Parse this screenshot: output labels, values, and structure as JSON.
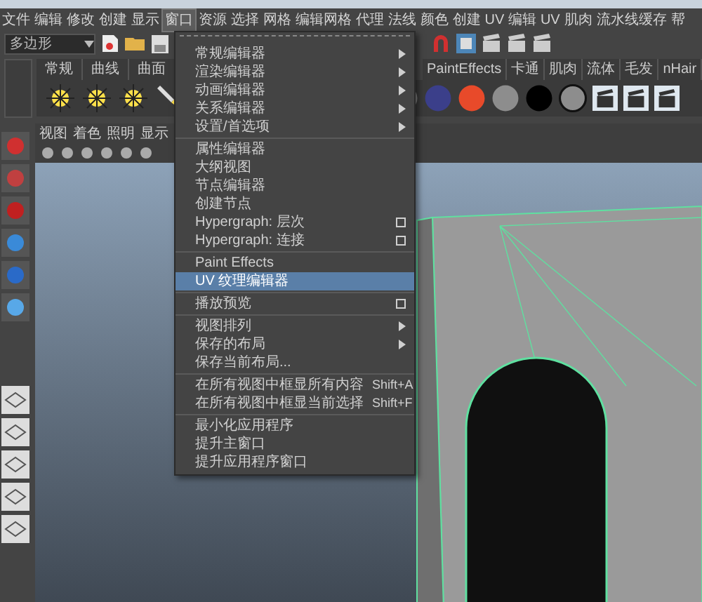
{
  "menubar": [
    {
      "label": "文件",
      "selected": false
    },
    {
      "label": "编辑",
      "selected": false
    },
    {
      "label": "修改",
      "selected": false
    },
    {
      "label": "创建",
      "selected": false
    },
    {
      "label": "显示",
      "selected": false
    },
    {
      "label": "窗口",
      "selected": true
    },
    {
      "label": "资源",
      "selected": false
    },
    {
      "label": "选择",
      "selected": false
    },
    {
      "label": "网格",
      "selected": false
    },
    {
      "label": "编辑网格",
      "selected": false
    },
    {
      "label": "代理",
      "selected": false
    },
    {
      "label": "法线",
      "selected": false
    },
    {
      "label": "颜色",
      "selected": false
    },
    {
      "label": "创建 UV",
      "selected": false
    },
    {
      "label": "编辑 UV",
      "selected": false
    },
    {
      "label": "肌肉",
      "selected": false
    },
    {
      "label": "流水线缓存",
      "selected": false
    },
    {
      "label": "帮",
      "selected": false
    }
  ],
  "mode_dropdown": {
    "value": "多边形"
  },
  "shelf_tabs_left": [
    "常规",
    "曲线",
    "曲面"
  ],
  "shelf_tabs_right": [
    "PaintEffects",
    "卡通",
    "肌肉",
    "流体",
    "毛发",
    "nHair"
  ],
  "panel_menu": [
    "视图",
    "着色",
    "照明",
    "显示"
  ],
  "window_menu": [
    [
      {
        "label": "常规编辑器",
        "kind": "submenu",
        "selected": false
      },
      {
        "label": "渲染编辑器",
        "kind": "submenu",
        "selected": false
      },
      {
        "label": "动画编辑器",
        "kind": "submenu",
        "selected": false
      },
      {
        "label": "关系编辑器",
        "kind": "submenu",
        "selected": false
      },
      {
        "label": "设置/首选项",
        "kind": "submenu",
        "selected": false
      }
    ],
    [
      {
        "label": "属性编辑器",
        "kind": "plain",
        "selected": false
      },
      {
        "label": "大纲视图",
        "kind": "plain",
        "selected": false
      },
      {
        "label": "节点编辑器",
        "kind": "plain",
        "selected": false
      },
      {
        "label": "创建节点",
        "kind": "plain",
        "selected": false
      },
      {
        "label": "Hypergraph: 层次",
        "kind": "option",
        "selected": false
      },
      {
        "label": "Hypergraph: 连接",
        "kind": "option",
        "selected": false
      }
    ],
    [
      {
        "label": "Paint Effects",
        "kind": "plain",
        "selected": false
      },
      {
        "label": "UV 纹理编辑器",
        "kind": "plain",
        "selected": true
      }
    ],
    [
      {
        "label": "播放预览",
        "kind": "option",
        "selected": false
      }
    ],
    [
      {
        "label": "视图排列",
        "kind": "submenu",
        "selected": false
      },
      {
        "label": "保存的布局",
        "kind": "submenu",
        "selected": false
      },
      {
        "label": "保存当前布局...",
        "kind": "plain",
        "selected": false
      }
    ],
    [
      {
        "label": "在所有视图中框显所有内容",
        "kind": "shortcut",
        "shortcut": "Shift+A",
        "selected": false
      },
      {
        "label": "在所有视图中框显当前选择",
        "kind": "shortcut",
        "shortcut": "Shift+F",
        "selected": false
      }
    ],
    [
      {
        "label": "最小化应用程序",
        "kind": "plain",
        "selected": false
      },
      {
        "label": "提升主窗口",
        "kind": "plain",
        "selected": false
      },
      {
        "label": "提升应用程序窗口",
        "kind": "plain",
        "selected": false
      }
    ]
  ]
}
